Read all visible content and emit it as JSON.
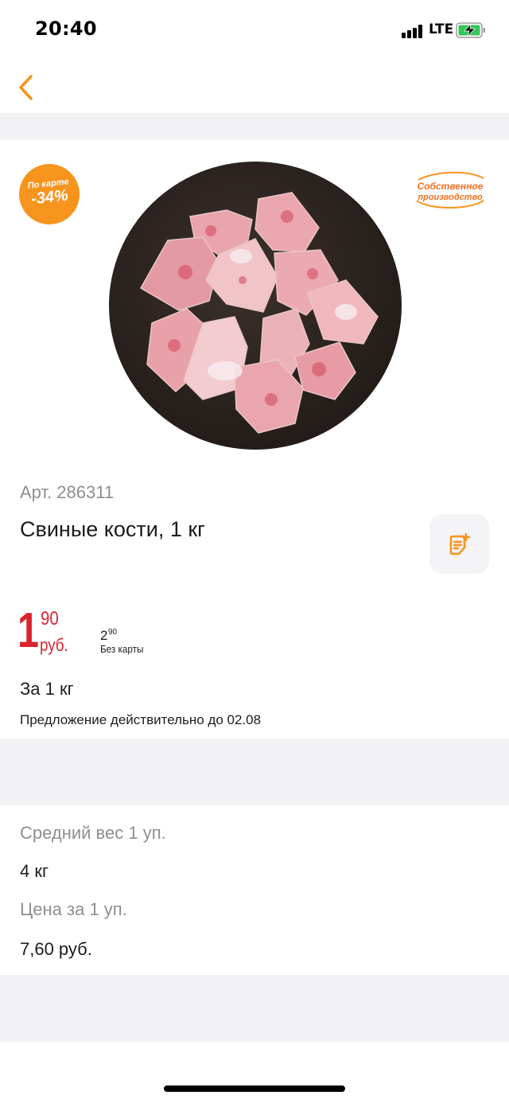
{
  "status_bar": {
    "time": "20:40",
    "network": "LTE"
  },
  "badges": {
    "discount_line1": "По карте",
    "discount_line2": "-34%",
    "own_production_line1": "Собственное",
    "own_production_line2": "производство"
  },
  "product": {
    "article": "Арт. 286311",
    "title": "Свиные кости, 1 кг"
  },
  "price": {
    "card_int": "1",
    "card_dec": "90",
    "currency": "руб.",
    "regular_int": "2",
    "regular_dec": "90",
    "regular_label": "Без карты",
    "per_unit": "За 1 кг",
    "validity": "Предложение действительно до 02.08"
  },
  "specs": [
    {
      "label": "Средний вес 1 уп.",
      "value": "4 кг"
    },
    {
      "label": "Цена за 1 уп.",
      "value": "7,60 руб."
    }
  ],
  "colors": {
    "accent": "#f7941d",
    "price_red": "#d9232d",
    "muted_text": "#8e8e93",
    "band_gray": "#f2f2f4"
  }
}
